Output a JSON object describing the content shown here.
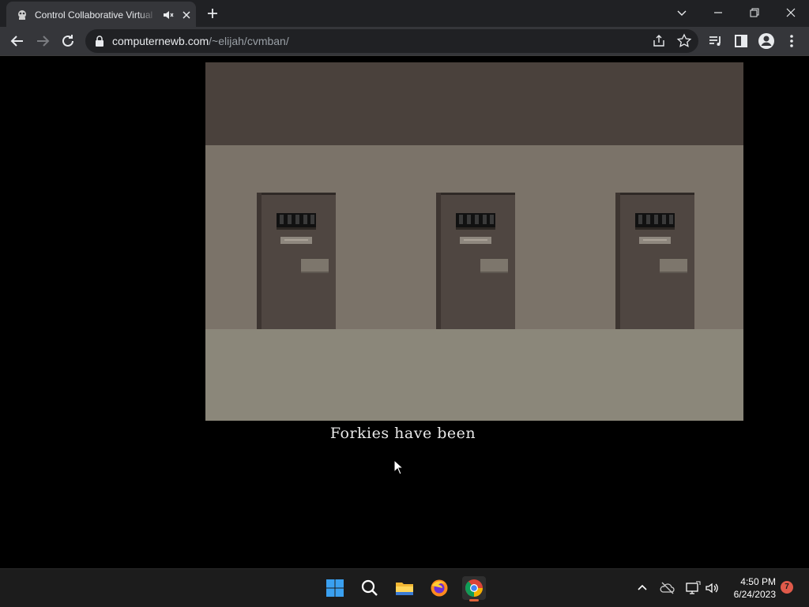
{
  "browser": {
    "tab": {
      "title": "Control Collaborative Virtual Ban",
      "favicon": "game-favicon-icon"
    },
    "address": {
      "host": "computernewb.com",
      "path": "/~elijah/cvmban/"
    }
  },
  "game": {
    "subtitle": "Forkies have been",
    "doors": 3
  },
  "taskbar": {
    "apps": [
      "start-icon",
      "search-icon",
      "file-explorer-icon",
      "firefox-icon",
      "chrome-icon"
    ],
    "time": "4:50 PM",
    "date": "6/24/2023",
    "notifications": "7"
  }
}
